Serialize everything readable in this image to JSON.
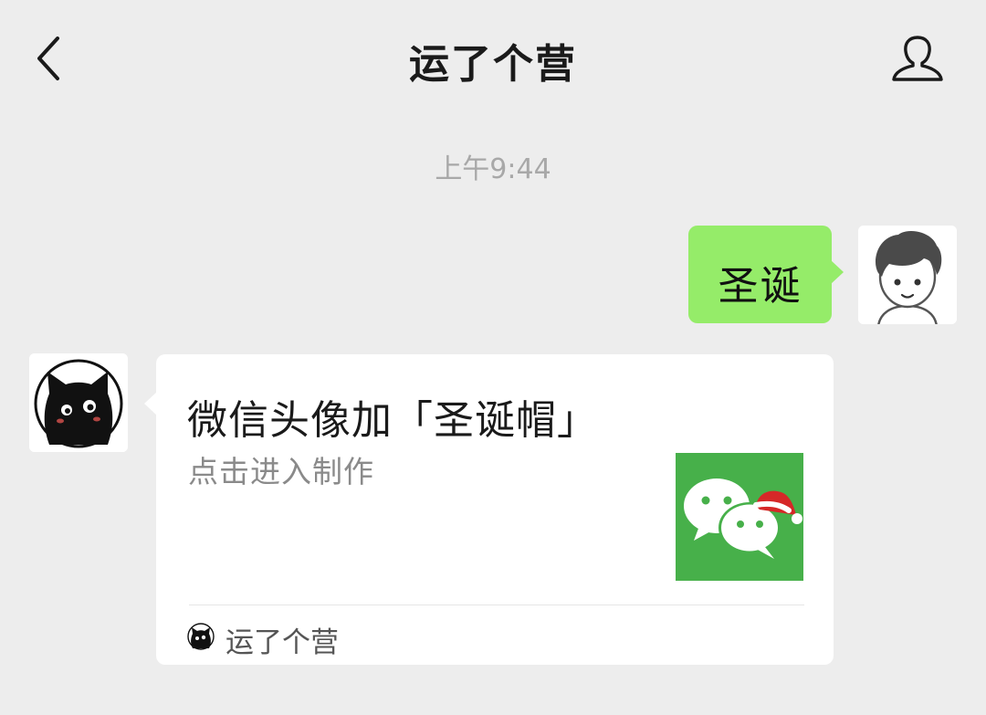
{
  "header": {
    "back_icon": "chevron-left-icon",
    "title": "运了个营",
    "profile_icon": "person-icon"
  },
  "timestamp": "上午9:44",
  "messages": [
    {
      "direction": "outgoing",
      "avatar": "boy-cartoon-avatar",
      "text": "圣诞",
      "bubble_color": "#95ec69"
    },
    {
      "direction": "incoming",
      "avatar": "black-cat-avatar",
      "card": {
        "title": "微信头像加「圣诞帽」",
        "description": "点击进入制作",
        "thumbnail": "wechat-logo-with-santa-hat",
        "thumbnail_color": "#47b04a",
        "source_icon": "black-cat-avatar",
        "source_name": "运了个营"
      }
    }
  ],
  "colors": {
    "background": "#ededed",
    "outgoing_bubble": "#95ec69",
    "timestamp_text": "#a8a8a8"
  }
}
